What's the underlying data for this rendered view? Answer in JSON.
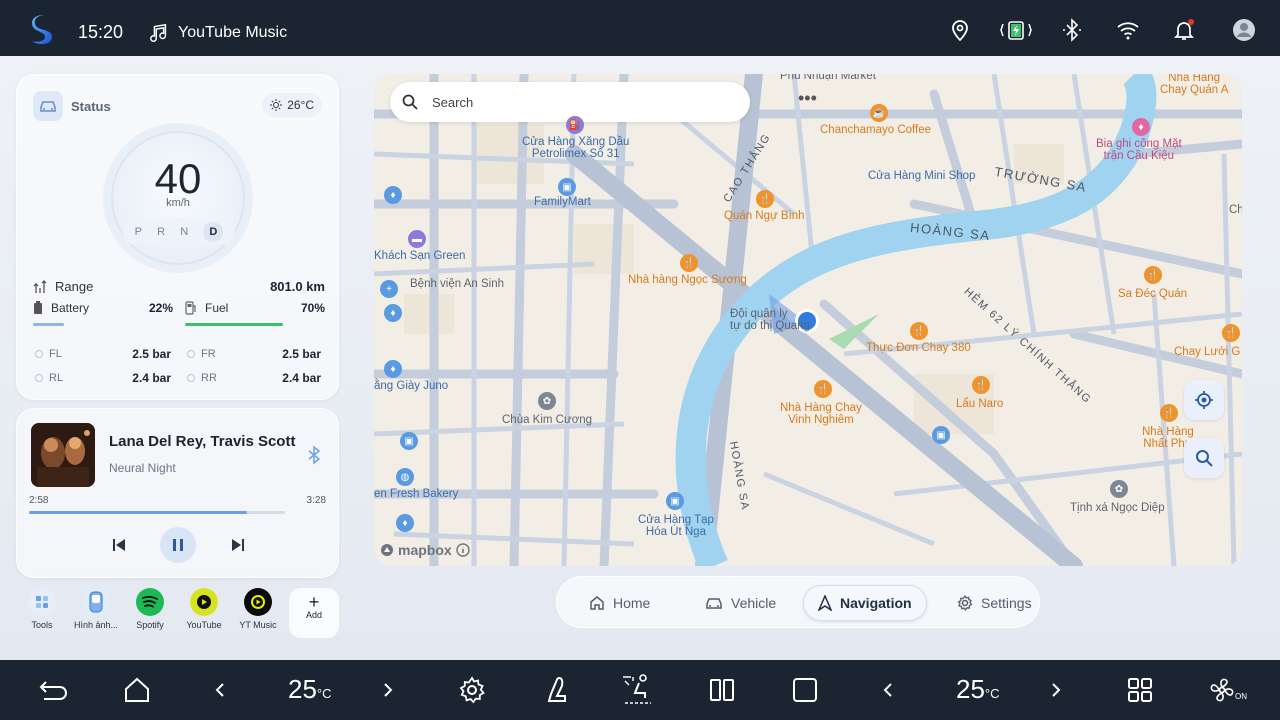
{
  "topbar": {
    "time": "15:20",
    "app": "YouTube Music"
  },
  "status": {
    "title": "Status",
    "temperature": "26°C",
    "speed": "40",
    "speed_unit": "km/h",
    "gears": [
      "P",
      "R",
      "N",
      "D"
    ],
    "active_gear": "D",
    "range_label": "Range",
    "range_value": "801.0 km",
    "battery_label": "Battery",
    "battery_value": "22%",
    "battery_level": 0.22,
    "fuel_label": "Fuel",
    "fuel_value": "70%",
    "fuel_level": 0.7,
    "tires": [
      {
        "label": "FL",
        "value": "2.5 bar"
      },
      {
        "label": "FR",
        "value": "2.5 bar"
      },
      {
        "label": "RL",
        "value": "2.4 bar"
      },
      {
        "label": "RR",
        "value": "2.4 bar"
      }
    ]
  },
  "music": {
    "title": "Lana Del Rey, Travis Scott",
    "album": "Neural Night",
    "current": "2:58",
    "total": "3:28",
    "progress": 0.85
  },
  "dock": [
    {
      "label": "Tools",
      "icon": "tools-icon"
    },
    {
      "label": "Hình ảnh...",
      "icon": "image-icon"
    },
    {
      "label": "Spotify",
      "icon": "spotify-icon"
    },
    {
      "label": "YouTube",
      "icon": "youtube-icon"
    },
    {
      "label": "YT Music",
      "icon": "yt-music-icon"
    }
  ],
  "dock_add": {
    "plus": "+",
    "label": "Add"
  },
  "map": {
    "search_placeholder": "Search",
    "more": "•••",
    "labels": {
      "phu_nhuan": "Phú Nhuận Market",
      "nha_hang_chay": "Nhà Hàng\nChay Quán A",
      "petrolimex": "Cửa Hàng Xăng Dầu\nPetrolimex Số 31",
      "chanchamayo": "Chanchamayo Coffee",
      "bia_ghi": "Bia ghi công Mặt\ntrận Cầu Kiệu",
      "cao_thang": "CAO THẮNG",
      "mini_shop": "Cửa Hàng Mini Shop",
      "truong_sa": "TRƯỜNG SA",
      "familymart": "FamilyMart",
      "quan_ngu_binh": "Quán Ngự Bình",
      "hoang_sa_1": "HOÀNG SA",
      "ks_san_green": "Khách Sạn Green",
      "nh_ngoc_suong": "Nhà hàng Ngọc Sương",
      "sa_dec_quan": "Sa Đéc Quán",
      "bv_an_sinh": "Bệnh viện An Sinh",
      "hem_62": "HẺM 62 LÝ CHÍNH THẮNG",
      "doi_quan": "Đội quân ly\ntự do thị Quang",
      "thuc_don": "Thực Đơn Chay 380",
      "chay_luoi": "Chay Lưới G",
      "giay_juno": "ằng Giày Juno",
      "lau_naro": "Lẩu Naro",
      "nh_chay_vinh": "Nhà Hàng Chay\nVinh Nghiêm",
      "chua_kim_cuong": "Chùa Kim Cương",
      "nha_hang_nhat": "Nhà Hàng\nNhất Phư",
      "hoang_sa_2": "HOÀNG SA",
      "fresh_bakery": "en Fresh Bakery",
      "tinh_xa": "Tịnh xá Ngọc Diệp",
      "cua_hang_tap": "Cửa Hàng Tạp\nHóa Út Nga",
      "ch": "Ch"
    },
    "attribution": "mapbox"
  },
  "nav": [
    {
      "label": "Home",
      "icon": "home-icon"
    },
    {
      "label": "Vehicle",
      "icon": "car-icon"
    },
    {
      "label": "Navigation",
      "icon": "navigation-icon"
    },
    {
      "label": "Settings",
      "icon": "gear-icon"
    }
  ],
  "nav_active": "Navigation",
  "climate": {
    "left_temp": "25",
    "right_temp": "25",
    "unit": "°C",
    "fan_state": "ON"
  },
  "colors": {
    "accent": "#6aa0e8",
    "fuel": "#3cc06a",
    "topbar": "#1b2431",
    "river": "#9fd3ef"
  }
}
